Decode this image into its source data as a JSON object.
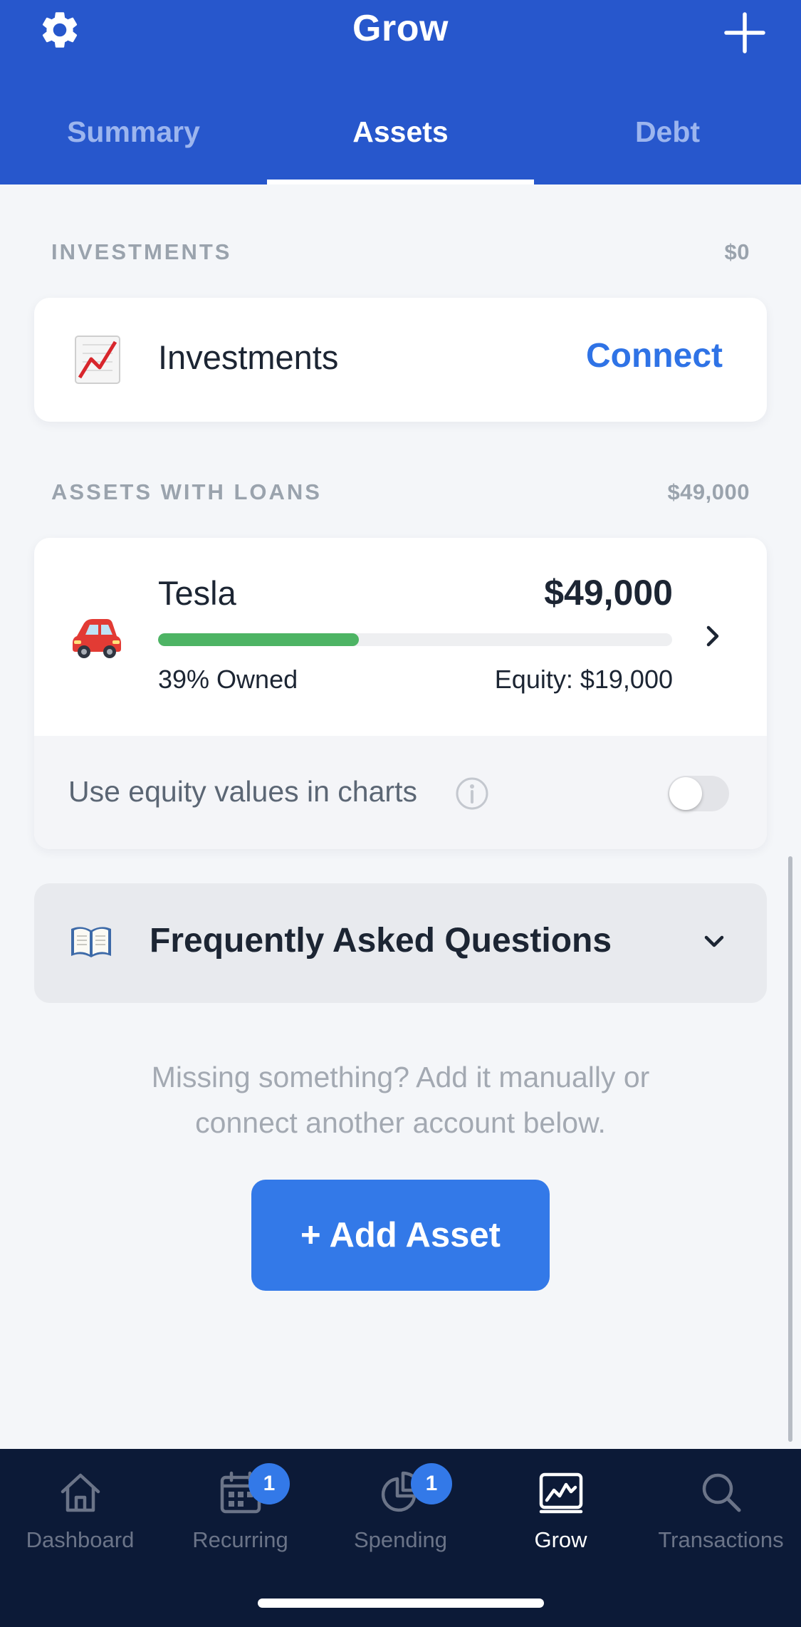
{
  "header": {
    "title": "Grow",
    "settings_icon": "gear-icon",
    "add_icon": "plus-icon",
    "tabs": [
      {
        "label": "Summary",
        "active": false
      },
      {
        "label": "Assets",
        "active": true
      },
      {
        "label": "Debt",
        "active": false
      }
    ]
  },
  "investments_section": {
    "heading": "INVESTMENTS",
    "total": "$0",
    "item": {
      "icon": "chart-increasing-icon",
      "label": "Investments",
      "action": "Connect"
    }
  },
  "assets_with_loans_section": {
    "heading": "ASSETS WITH LOANS",
    "total": "$49,000",
    "asset": {
      "icon": "car-icon",
      "name": "Tesla",
      "value": "$49,000",
      "owned_fraction": 0.39,
      "owned_label": "39% Owned",
      "equity_label": "Equity: $19,000"
    },
    "equity_toggle": {
      "label": "Use equity values in charts",
      "enabled": false
    }
  },
  "faq": {
    "icon": "open-book-icon",
    "title": "Frequently Asked Questions"
  },
  "missing": {
    "line1": "Missing something? Add it manually or",
    "line2": "connect another account below."
  },
  "add_asset_label": "+ Add Asset",
  "bottom_nav": [
    {
      "label": "Dashboard",
      "icon": "home-icon",
      "badge": "",
      "active": false
    },
    {
      "label": "Recurring",
      "icon": "calendar-icon",
      "badge": "1",
      "active": false
    },
    {
      "label": "Spending",
      "icon": "pie-chart-icon",
      "badge": "1",
      "active": false
    },
    {
      "label": "Grow",
      "icon": "growth-chart-icon",
      "badge": "",
      "active": true
    },
    {
      "label": "Transactions",
      "icon": "search-icon",
      "badge": "",
      "active": false
    }
  ],
  "colors": {
    "header_bg": "#2757cc",
    "accent": "#3379e8",
    "progress_green": "#4db464",
    "nav_bg": "#0c1a37"
  }
}
